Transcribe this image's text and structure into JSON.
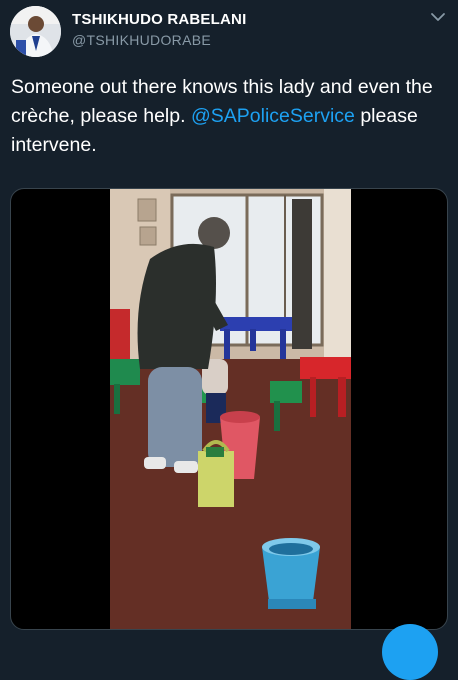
{
  "tweet": {
    "author_name": "TSHIKHUDO RABELANI",
    "author_handle": "@TSHIKHUDORABE",
    "text_part1": "Someone out there knows this lady and even the crèche, please help. ",
    "mention": "@SAPoliceService",
    "text_part2": " please intervene.",
    "menu_icon": "chevron-down-icon"
  },
  "media": {
    "type": "video",
    "scene": "creche-classroom"
  },
  "colors": {
    "background": "#15202b",
    "secondary_text": "#8899a6",
    "accent": "#1da1f2"
  }
}
